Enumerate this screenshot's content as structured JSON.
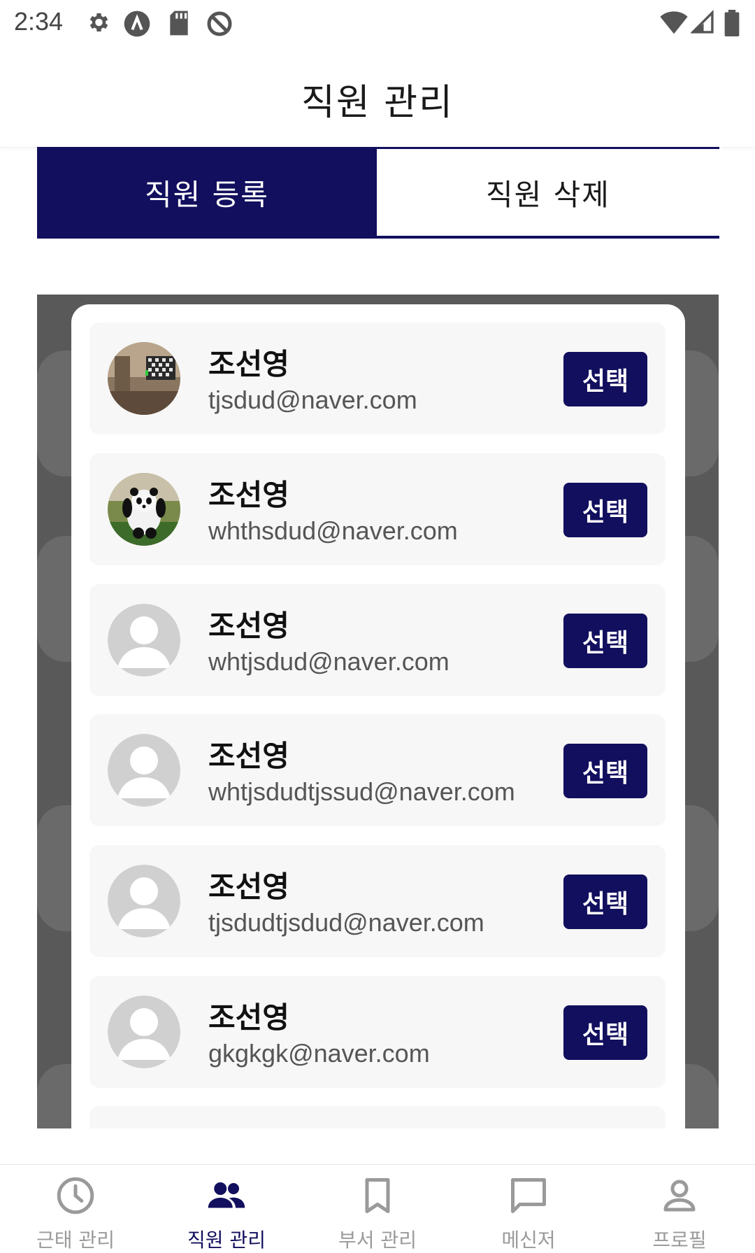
{
  "status_bar": {
    "time": "2:34"
  },
  "header": {
    "title": "직원 관리"
  },
  "tabs": [
    {
      "label": "직원 등록",
      "active": true
    },
    {
      "label": "직원 삭제",
      "active": false
    }
  ],
  "employees": [
    {
      "name": "조선영",
      "email": "tjsdud@naver.com",
      "select_label": "선택",
      "avatar": "room-photo"
    },
    {
      "name": "조선영",
      "email": "whthsdud@naver.com",
      "select_label": "선택",
      "avatar": "panda-photo"
    },
    {
      "name": "조선영",
      "email": "whtjsdud@naver.com",
      "select_label": "선택",
      "avatar": "default-person"
    },
    {
      "name": "조선영",
      "email": "whtjsdudtjssud@naver.com",
      "select_label": "선택",
      "avatar": "default-person"
    },
    {
      "name": "조선영",
      "email": "tjsdudtjsdud@naver.com",
      "select_label": "선택",
      "avatar": "default-person"
    },
    {
      "name": "조선영",
      "email": "gkgkgk@naver.com",
      "select_label": "선택",
      "avatar": "default-person"
    }
  ],
  "bottom_nav": [
    {
      "label": "근태 관리",
      "icon": "clock-icon",
      "active": false
    },
    {
      "label": "직원 관리",
      "icon": "people-icon",
      "active": true
    },
    {
      "label": "부서 관리",
      "icon": "bookmark-icon",
      "active": false
    },
    {
      "label": "메신저",
      "icon": "chat-icon",
      "active": false
    },
    {
      "label": "프로필",
      "icon": "person-icon",
      "active": false
    }
  ],
  "colors": {
    "primary": "#120f5e",
    "inactive": "#9a9a9a",
    "overlay": "#595959"
  }
}
